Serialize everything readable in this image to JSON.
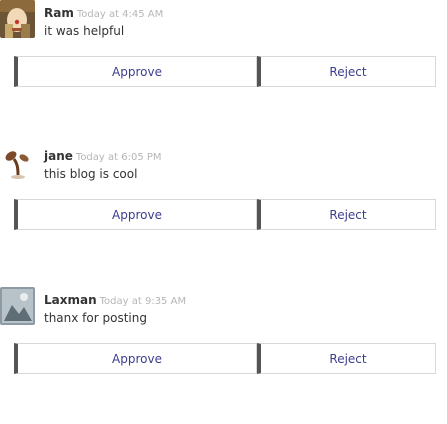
{
  "comments": [
    {
      "author": "Ram",
      "time": "Today at 4:45 AM",
      "text": "it was helpful",
      "approve_label": "Approve",
      "reject_label": "Reject",
      "avatar_icon": "clown-avatar-icon"
    },
    {
      "author": "jane",
      "time": "Today at 6:05 PM",
      "text": "this blog is cool",
      "approve_label": "Approve",
      "reject_label": "Reject",
      "avatar_icon": "plant-sprout-avatar-icon"
    },
    {
      "author": "Laxman",
      "time": "Today at 9:35 AM",
      "text": "thanx for posting",
      "approve_label": "Approve",
      "reject_label": "Reject",
      "avatar_icon": "photo-avatar-icon"
    }
  ],
  "colors": {
    "button_text": "#3d3d8f",
    "button_accent_border": "#555555",
    "timestamp": "#b6b6b6"
  }
}
